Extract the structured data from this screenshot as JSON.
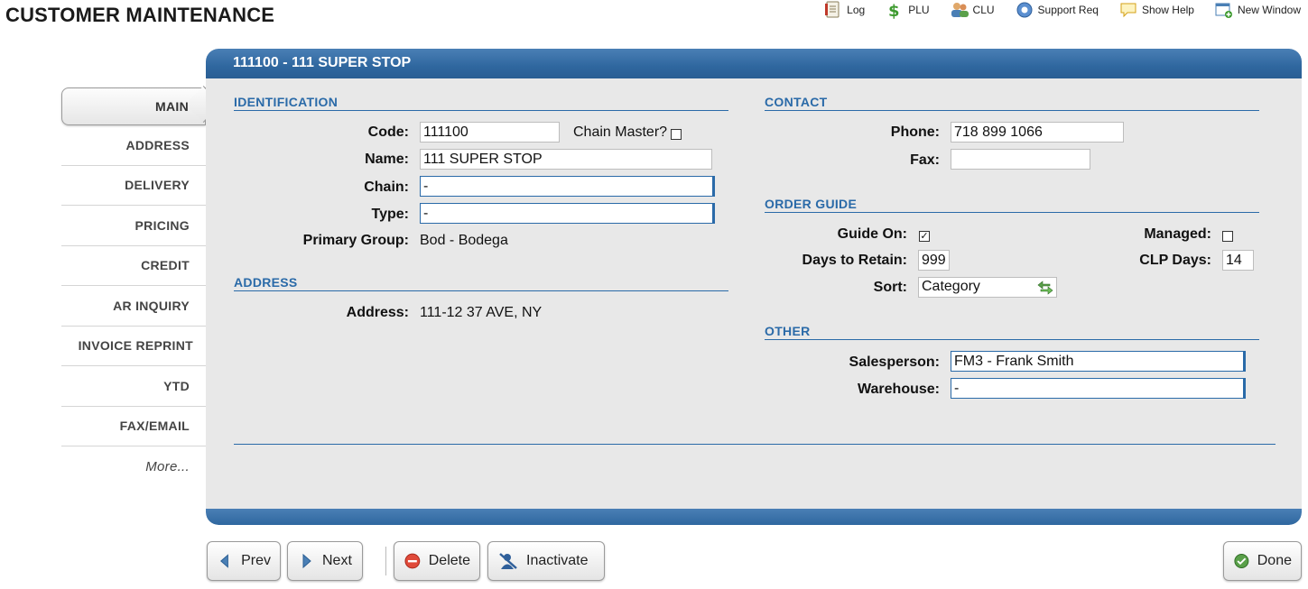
{
  "page_title": "CUSTOMER MAINTENANCE",
  "toolbar": [
    {
      "label": "Log",
      "icon": "log-icon"
    },
    {
      "label": "PLU",
      "icon": "dollar-icon"
    },
    {
      "label": "CLU",
      "icon": "users-icon"
    },
    {
      "label": "Support Req",
      "icon": "support-icon"
    },
    {
      "label": "Show Help",
      "icon": "help-bubble-icon"
    },
    {
      "label": "New Window",
      "icon": "new-window-icon"
    }
  ],
  "sidebar": {
    "items": [
      {
        "label": "MAIN",
        "active": true
      },
      {
        "label": "ADDRESS"
      },
      {
        "label": "DELIVERY"
      },
      {
        "label": "PRICING"
      },
      {
        "label": "CREDIT"
      },
      {
        "label": "AR INQUIRY"
      },
      {
        "label": "INVOICE REPRINT"
      },
      {
        "label": "YTD"
      },
      {
        "label": "FAX/EMAIL"
      },
      {
        "label": "More..."
      }
    ]
  },
  "panel": {
    "title": "111100 - 111 SUPER STOP",
    "identification": {
      "heading": "IDENTIFICATION",
      "code_label": "Code:",
      "code_value": "111100",
      "chain_master_label": "Chain Master?",
      "chain_master_checked": false,
      "name_label": "Name:",
      "name_value": "111 SUPER STOP",
      "chain_label": "Chain:",
      "chain_value": "-",
      "type_label": "Type:",
      "type_value": "-",
      "primary_group_label": "Primary Group:",
      "primary_group_value": "Bod - Bodega"
    },
    "address": {
      "heading": "ADDRESS",
      "address_label": "Address:",
      "address_value": "111-12 37 AVE, NY"
    },
    "contact": {
      "heading": "CONTACT",
      "phone_label": "Phone:",
      "phone_value": "718 899 1066",
      "fax_label": "Fax:",
      "fax_value": ""
    },
    "order_guide": {
      "heading": "ORDER GUIDE",
      "guide_on_label": "Guide On:",
      "guide_on_checked": true,
      "managed_label": "Managed:",
      "managed_checked": false,
      "days_to_retain_label": "Days to Retain:",
      "days_to_retain_value": "999",
      "clp_days_label": "CLP Days:",
      "clp_days_value": "14",
      "sort_label": "Sort:",
      "sort_value": "Category"
    },
    "other": {
      "heading": "OTHER",
      "salesperson_label": "Salesperson:",
      "salesperson_value": "FM3 - Frank Smith",
      "warehouse_label": "Warehouse:",
      "warehouse_value": "-"
    }
  },
  "buttons": {
    "prev": "Prev",
    "next": "Next",
    "delete": "Delete",
    "inactivate": "Inactivate",
    "done": "Done"
  },
  "colors": {
    "accent": "#2a6aa8",
    "header_bar": "#2f679f",
    "panel_bg": "#e8e8e8"
  }
}
